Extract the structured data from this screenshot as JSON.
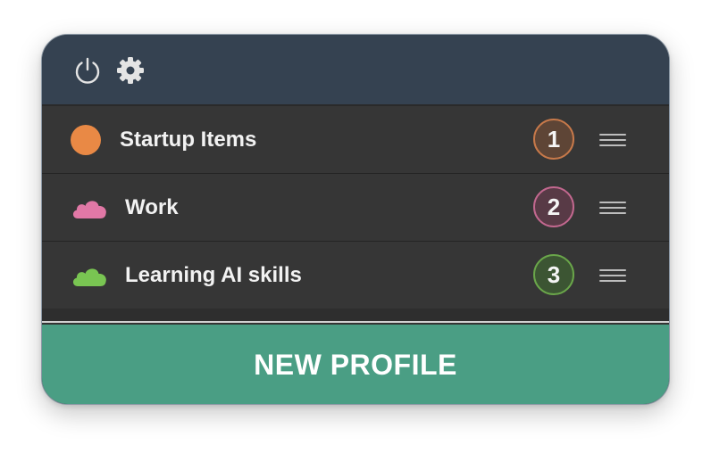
{
  "header": {
    "power_icon": "power-icon",
    "settings_icon": "gear-icon",
    "icon_color": "#e4e4e4"
  },
  "profiles": [
    {
      "label": "Startup Items",
      "number": "1",
      "icon": "circle-dot-icon",
      "color": "#e98945",
      "badge_bg": "#5e4536",
      "badge_border": "#c7794a"
    },
    {
      "label": "Work",
      "number": "2",
      "icon": "cloud-icon",
      "color": "#e178a6",
      "badge_bg": "#583a46",
      "badge_border": "#c2688f"
    },
    {
      "label": "Learning AI skills",
      "number": "3",
      "icon": "cloud-icon",
      "color": "#79c552",
      "badge_bg": "#3c5533",
      "badge_border": "#6aa64a"
    }
  ],
  "footer": {
    "new_profile_label": "NEW PROFILE",
    "accent_color": "#4a9e84"
  }
}
